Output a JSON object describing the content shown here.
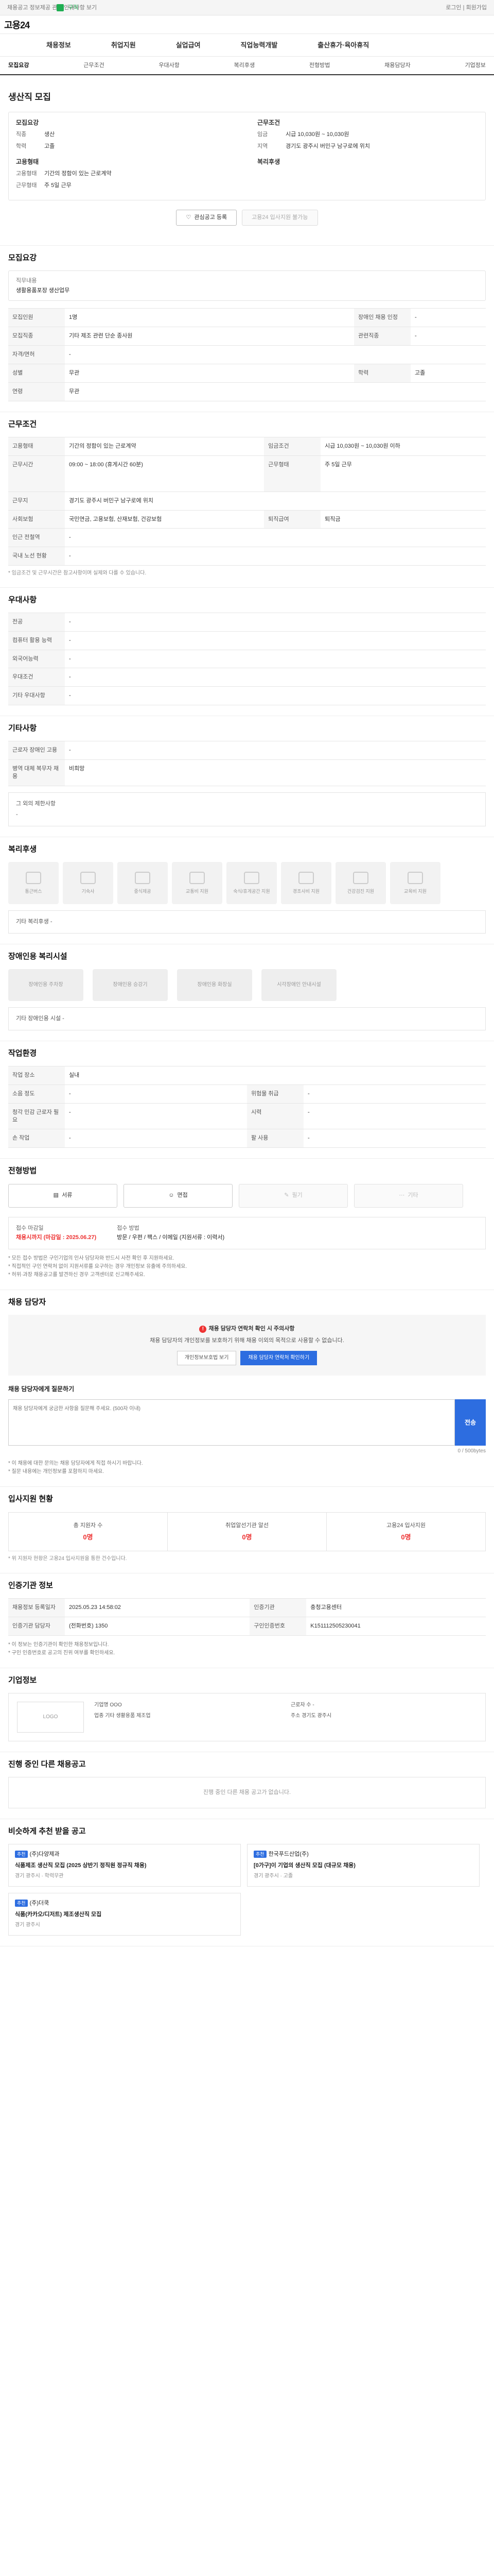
{
  "topbar": {
    "notice": "채용공고 정보제공 관련 안내사항 보기",
    "greentext": "구직",
    "right": "로그인 | 회원가입"
  },
  "brand": {
    "logo": "고용24"
  },
  "gnb": [
    "채용정보",
    "취업지원",
    "실업급여",
    "직업능력개발",
    "출산휴가·육아휴직"
  ],
  "tabs": [
    "모집요강",
    "근무조건",
    "우대사항",
    "복리후생",
    "전형방법",
    "채용담당자",
    "기업정보"
  ],
  "job": {
    "title": "생산직 모집",
    "recruit_head": "모집요강",
    "recruit_rows": [
      {
        "k": "직종",
        "v": "생산"
      },
      {
        "k": "학력",
        "v": "고졸"
      }
    ],
    "cond_head": "근무조건",
    "cond_rows": [
      {
        "k": "임금",
        "v": "시급 10,030원 ~ 10,030원"
      },
      {
        "k": "지역",
        "v": "경기도 광주시 버민구 남구로에 위치"
      }
    ],
    "emp_head": "고용형태",
    "emp_rows": [
      {
        "k": "고용형태",
        "v": "기간의 정함이 있는 근로계약"
      },
      {
        "k": "근무형태",
        "v": "주 5일 근무"
      }
    ],
    "welfare_head": "복리후생"
  },
  "buttons": {
    "interest": "관심공고 등록",
    "apply": "고용24 입사지원 불가능"
  },
  "s_recruit": {
    "title": "모집요강",
    "label": "직무내용",
    "value": "생활용품포장 생산업무",
    "rows": [
      [
        "모집인원",
        "1명",
        "장애인 채용 인정",
        "-"
      ],
      [
        "모집직종",
        "기타 제조 관련 단순 종사원",
        "관련직종",
        "-"
      ],
      [
        "자격/면허",
        "-",
        "",
        ""
      ],
      [
        "성별",
        "무관",
        "학력",
        "고졸"
      ],
      [
        "연령",
        "무관",
        "",
        ""
      ]
    ]
  },
  "s_cond": {
    "title": "근무조건",
    "rows": [
      [
        "고용형태",
        "기간의 정함이 있는 근로계약",
        "임금조건",
        "시급 10,030원 ~ 10,030원 이하"
      ],
      [
        "근무시간",
        "09:00 ~ 18:00 (휴게시간 60분)",
        "근무형태",
        "주 5일 근무"
      ],
      [
        "근무지",
        "경기도 광주시 버민구 남구로에 위치",
        "",
        ""
      ],
      [
        "사회보험",
        "국민연금, 고용보험, 산재보험, 건강보험",
        "퇴직급여",
        "퇴직금"
      ],
      [
        "인근 전철역",
        "-",
        "",
        ""
      ],
      [
        "국내 노선 현황",
        "-",
        "",
        ""
      ]
    ],
    "note": "* 임금조건 및 근무시간은 참고사항이며 실제와 다를 수 있습니다."
  },
  "s_pref": {
    "title": "우대사항",
    "rows": [
      [
        "전공",
        "-"
      ],
      [
        "컴퓨터 활용 능력",
        "-"
      ],
      [
        "외국어능력",
        "-"
      ],
      [
        "우대조건",
        "-"
      ],
      [
        "기타 우대사항",
        "-"
      ]
    ]
  },
  "s_etc": {
    "title": "기타사항",
    "rows": [
      [
        "근로자 장애인 고용",
        "-"
      ],
      [
        "병역 대체 복무자 채용",
        "비희망"
      ]
    ],
    "sub": "그 외의 제한사항",
    "subv": "-"
  },
  "s_welfare": {
    "title": "복리후생",
    "items": [
      "통근버스",
      "기숙사",
      "중식제공",
      "교통비 지원",
      "숙식/휴게공간 지원",
      "경조사비 지원",
      "건강검진 지원",
      "교육비 지원"
    ],
    "etc_label": "기타 복리후생",
    "etc_value": "-"
  },
  "s_dis": {
    "title": "장애인용 복리시설",
    "items": [
      "장애인용 주차장",
      "장애인용 승강기",
      "장애인용 화장실",
      "시각장애인 안내시설"
    ],
    "etc_label": "기타 장애인용 시설",
    "etc_value": "-"
  },
  "s_work": {
    "title": "작업환경",
    "rows": [
      [
        "작업 장소",
        "실내",
        "",
        ""
      ],
      [
        "소음 정도",
        "-",
        "위험물 취급",
        "-"
      ],
      [
        "청각 민감 근로자 필요",
        "-",
        "시력",
        "-"
      ],
      [
        "손 작업",
        "-",
        "팔 사용",
        "-"
      ]
    ]
  },
  "s_method": {
    "title": "전형방법",
    "methods": [
      "서류",
      "면접",
      "필기",
      "기타"
    ],
    "proc_label": "접수 마감일",
    "proc_value": "채용시까지 (마감일 : 2025.06.27)",
    "proc_label2": "접수 방법",
    "proc_value2": "방문 / 우편 / 팩스 / 이메일 (지원서류 : 이력서)",
    "bullets": [
      "* 모든 접수 방법은 구인기업의 인사 담당자와 반드시 사전 확인 후 지원하세요.",
      "* 직접적인 구인 연락처 없이 지원서류를 요구하는 경우 개인정보 유출에 주의하세요.",
      "* 허위·과장 채용공고를 발견하신 경우 고객센터로 신고해주세요."
    ]
  },
  "s_contact": {
    "title": "채용 담당자",
    "alert_title": "채용 담당자 연락처 확인 시 주의사항",
    "alert_text": "채용 담당자의 개인정보를 보호하기 위해 채용 이외의 목적으로 사용할 수 없습니다.",
    "btn1": "개인정보보호법 보기",
    "btn2": "채용 담당자 연락처 확인하기",
    "qa_title": "채용 담당자에게 질문하기",
    "qa_placeholder": "채용 담당자에게 궁금한 사항을 질문해 주세요. (500자 이내)",
    "qa_send": "전송",
    "qa_count": "0 / 500bytes",
    "notes": [
      "* 이 채용에 대한 문의는 채용 담당자에게 직접 하시기 바랍니다.",
      "* 질문 내용에는 개인정보를 포함하지 마세요."
    ]
  },
  "s_stats": {
    "title": "입사지원 현황",
    "items": [
      {
        "l": "총 지원자 수",
        "v": "0명"
      },
      {
        "l": "취업알선기관 알선",
        "v": "0명"
      },
      {
        "l": "고용24 입사지원",
        "v": "0명"
      }
    ],
    "note": "* 위 지원자 현황은 고용24 입사지원을 통한 건수입니다."
  },
  "s_info": {
    "title": "인증기관 정보",
    "rows": [
      [
        "채용정보 등록일자",
        "2025.05.23 14:58:02",
        "인증기관",
        "충청고용센터"
      ],
      [
        "인증기관 담당자",
        "(전화번호) 1350",
        "구인인증번호",
        "K151112505230041"
      ]
    ],
    "bullets": [
      "* 이 정보는 인증기관이 확인한 채용정보입니다.",
      "* 구인 인증번호로 공고의 진위 여부를 확인하세요."
    ]
  },
  "s_company": {
    "title": "기업정보",
    "logo": "LOGO",
    "rows": [
      [
        "기업명",
        "OOO"
      ],
      [
        "업종",
        "기타 생활용품 제조업"
      ],
      [
        "근로자 수",
        "-"
      ],
      [
        "주소",
        "경기도 광주시"
      ]
    ]
  },
  "s_other": {
    "title": "진행 중인 다른 채용공고",
    "empty": "진행 중인 다른 채용 공고가 없습니다."
  },
  "s_reco": {
    "title": "비슷하게 추천 받을 공고",
    "cards": [
      {
        "badge": "추천",
        "company": "(주)다양제과",
        "title": "식품제조 생산직 모집 (2025 상반기 정직원 정규직 채용)",
        "tags": "경기 광주시 · 학력무관"
      },
      {
        "badge": "추천",
        "company": "한국푸드산업(주)",
        "title": "[0가구]이 기업의 생산직 모집 (대규모 채용)",
        "tags": "경기 광주시 · 고졸"
      },
      {
        "badge": "추천",
        "company": "(주)더쿡",
        "title": "식품(카카오/디저트) 제조생산직 모집",
        "tags": "경기 광주시"
      }
    ]
  }
}
